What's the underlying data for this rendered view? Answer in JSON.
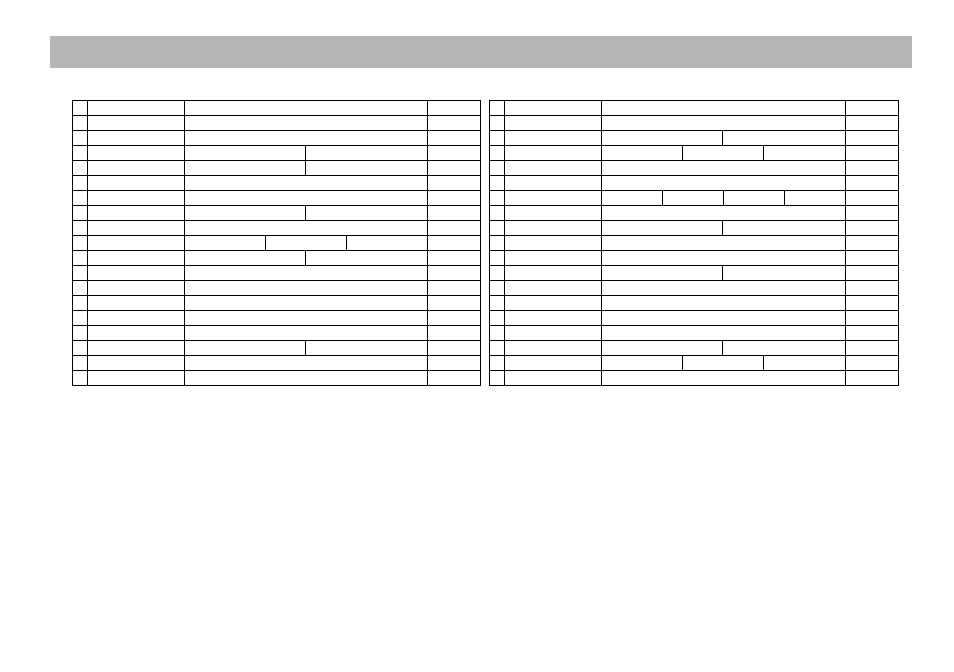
{
  "header": {
    "title": ""
  },
  "tables": [
    {
      "columns": [
        "",
        "",
        "",
        ""
      ],
      "rows": [
        {
          "col2_split": null
        },
        {
          "col2_split": null
        },
        {
          "col2_split": null
        },
        {
          "col2_split": [
            120,
            120
          ]
        },
        {
          "col2_split": [
            120,
            120
          ]
        },
        {
          "col2_split": null
        },
        {
          "col2_split": null
        },
        {
          "col2_split": [
            120,
            120
          ]
        },
        {
          "col2_split": null
        },
        {
          "col2_split": [
            80,
            80,
            80
          ]
        },
        {
          "col2_split": [
            120,
            120
          ]
        },
        {
          "col2_split": null
        },
        {
          "col2_split": null
        },
        {
          "col2_split": null
        },
        {
          "col2_split": null
        },
        {
          "col2_split": null
        },
        {
          "col2_split": [
            120,
            120
          ]
        },
        {
          "col2_split": null
        },
        {
          "col2_split": null
        }
      ]
    },
    {
      "columns": [
        "",
        "",
        "",
        ""
      ],
      "rows": [
        {
          "col2_split": null
        },
        {
          "col2_split": null
        },
        {
          "col2_split": [
            120,
            120
          ]
        },
        {
          "col2_split": [
            80,
            80,
            80
          ]
        },
        {
          "col2_split": null
        },
        {
          "col2_split": null
        },
        {
          "col2_split": [
            60,
            60,
            60,
            60
          ]
        },
        {
          "col2_split": null
        },
        {
          "col2_split": [
            120,
            120
          ]
        },
        {
          "col2_split": null
        },
        {
          "col2_split": null
        },
        {
          "col2_split": [
            120,
            120
          ]
        },
        {
          "col2_split": null
        },
        {
          "col2_split": null
        },
        {
          "col2_split": null
        },
        {
          "col2_split": null
        },
        {
          "col2_split": [
            120,
            120
          ]
        },
        {
          "col2_split": [
            80,
            80,
            80
          ]
        },
        {
          "col2_split": null
        }
      ]
    }
  ]
}
